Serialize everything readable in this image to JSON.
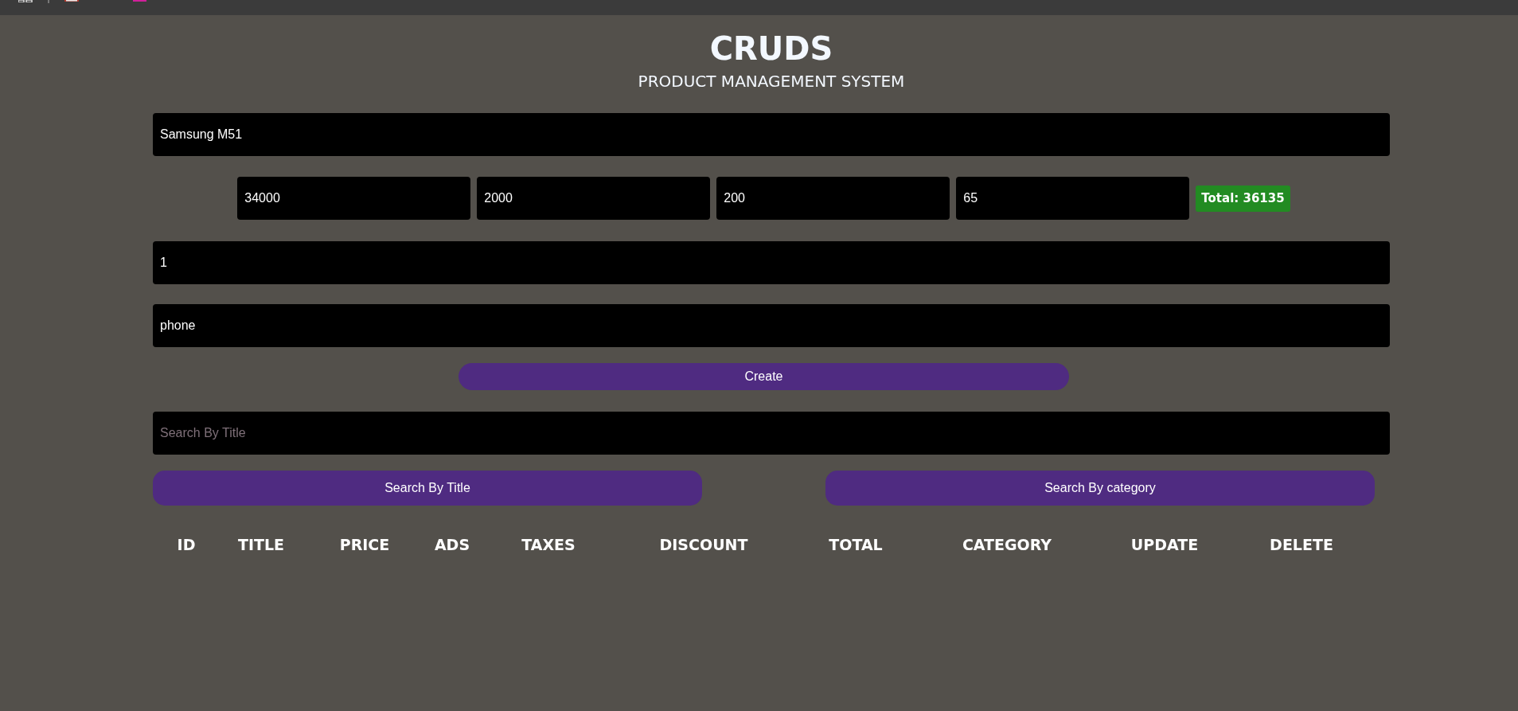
{
  "header": {
    "title": "CRUDS",
    "subtitle": "PRODUCT MANAGEMENT SYSTEM"
  },
  "form": {
    "title_field": {
      "value": "Samsung M51"
    },
    "price_fields": [
      {
        "value": "34000"
      },
      {
        "value": "2000"
      },
      {
        "value": "200"
      },
      {
        "value": "65"
      }
    ],
    "total": "Total: 36135",
    "count_field": {
      "value": "1"
    },
    "category_field": {
      "value": "phone"
    },
    "create_button": "Create"
  },
  "search": {
    "field": {
      "placeholder": "Search By Title"
    },
    "buttons": [
      "Search By Title",
      "Search By category"
    ]
  },
  "table": {
    "columns": [
      "ID",
      "TITLE",
      "PRICE",
      "ADS",
      "TAXES",
      "DISCOUNT",
      "TOTAL",
      "CATEGORY",
      "UPDATE",
      "DELETE"
    ]
  }
}
